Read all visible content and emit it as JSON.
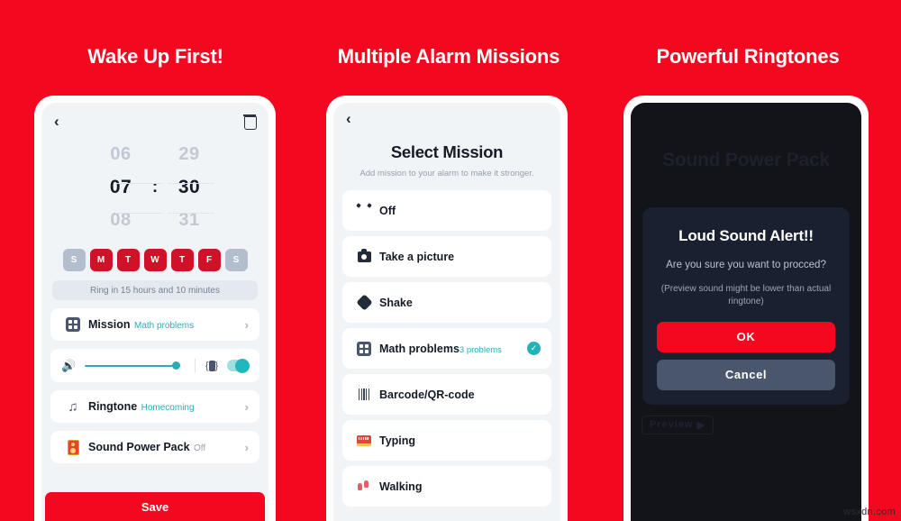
{
  "theme": {
    "brand_red": "#f4081f",
    "teal": "#2aacb4",
    "dark_navy": "#1b2030",
    "day_on": "#cf1228",
    "day_off": "#b2becd"
  },
  "panels": [
    {
      "title": "Wake Up First!"
    },
    {
      "title": "Multiple Alarm Missions"
    },
    {
      "title": "Powerful Ringtones"
    }
  ],
  "phone1": {
    "back_icon": "‹",
    "trash_icon": "trash-icon",
    "time": {
      "hour_prev": "06",
      "hour_current": "07",
      "hour_next": "08",
      "colon": ":",
      "minute_prev": "29",
      "minute_current": "30",
      "minute_next": "31"
    },
    "days": [
      {
        "label": "S",
        "active": false
      },
      {
        "label": "M",
        "active": true
      },
      {
        "label": "T",
        "active": true
      },
      {
        "label": "W",
        "active": true
      },
      {
        "label": "T",
        "active": true
      },
      {
        "label": "F",
        "active": true
      },
      {
        "label": "S",
        "active": false
      }
    ],
    "ring_status": "Ring in 15 hours and 10 minutes",
    "rows": {
      "mission": {
        "label": "Mission",
        "value": "Math problems",
        "chevron": "›"
      },
      "ringtone": {
        "label": "Ringtone",
        "value": "Homecoming",
        "chevron": "›"
      },
      "sound_power_pack": {
        "label": "Sound Power Pack",
        "value": "Off",
        "chevron": "›"
      }
    },
    "volume": {
      "speaker_icon": "🔊",
      "vibrate_icon": "vibrate-icon",
      "toggle_on": true
    },
    "save_label": "Save"
  },
  "phone2": {
    "back_icon": "‹",
    "title": "Select Mission",
    "subtitle": "Add mission to your alarm to make it stronger.",
    "missions": [
      {
        "label": "Off",
        "sub": "",
        "icon": "alarm-clock-icon",
        "selected": false
      },
      {
        "label": "Take a picture",
        "sub": "",
        "icon": "camera-icon",
        "selected": false
      },
      {
        "label": "Shake",
        "sub": "",
        "icon": "shake-icon",
        "selected": false
      },
      {
        "label": "Math problems",
        "sub": "3 problems",
        "icon": "math-grid-icon",
        "selected": true
      },
      {
        "label": "Barcode/QR-code",
        "sub": "",
        "icon": "barcode-icon",
        "selected": false
      },
      {
        "label": "Typing",
        "sub": "",
        "icon": "keyboard-icon",
        "selected": false
      },
      {
        "label": "Walking",
        "sub": "",
        "icon": "footprints-icon",
        "selected": false
      }
    ],
    "check_glyph": "✓"
  },
  "phone3": {
    "background_title": "Sound Power Pack",
    "dialog": {
      "title": "Loud Sound Alert!!",
      "body": "Are you sure you want to procced?",
      "note": "(Preview sound might be lower than actual ringtone)",
      "ok_label": "OK",
      "cancel_label": "Cancel"
    },
    "preview_label": "Preview",
    "preview_glyph": "▶"
  },
  "watermark": "wsxdn.com"
}
